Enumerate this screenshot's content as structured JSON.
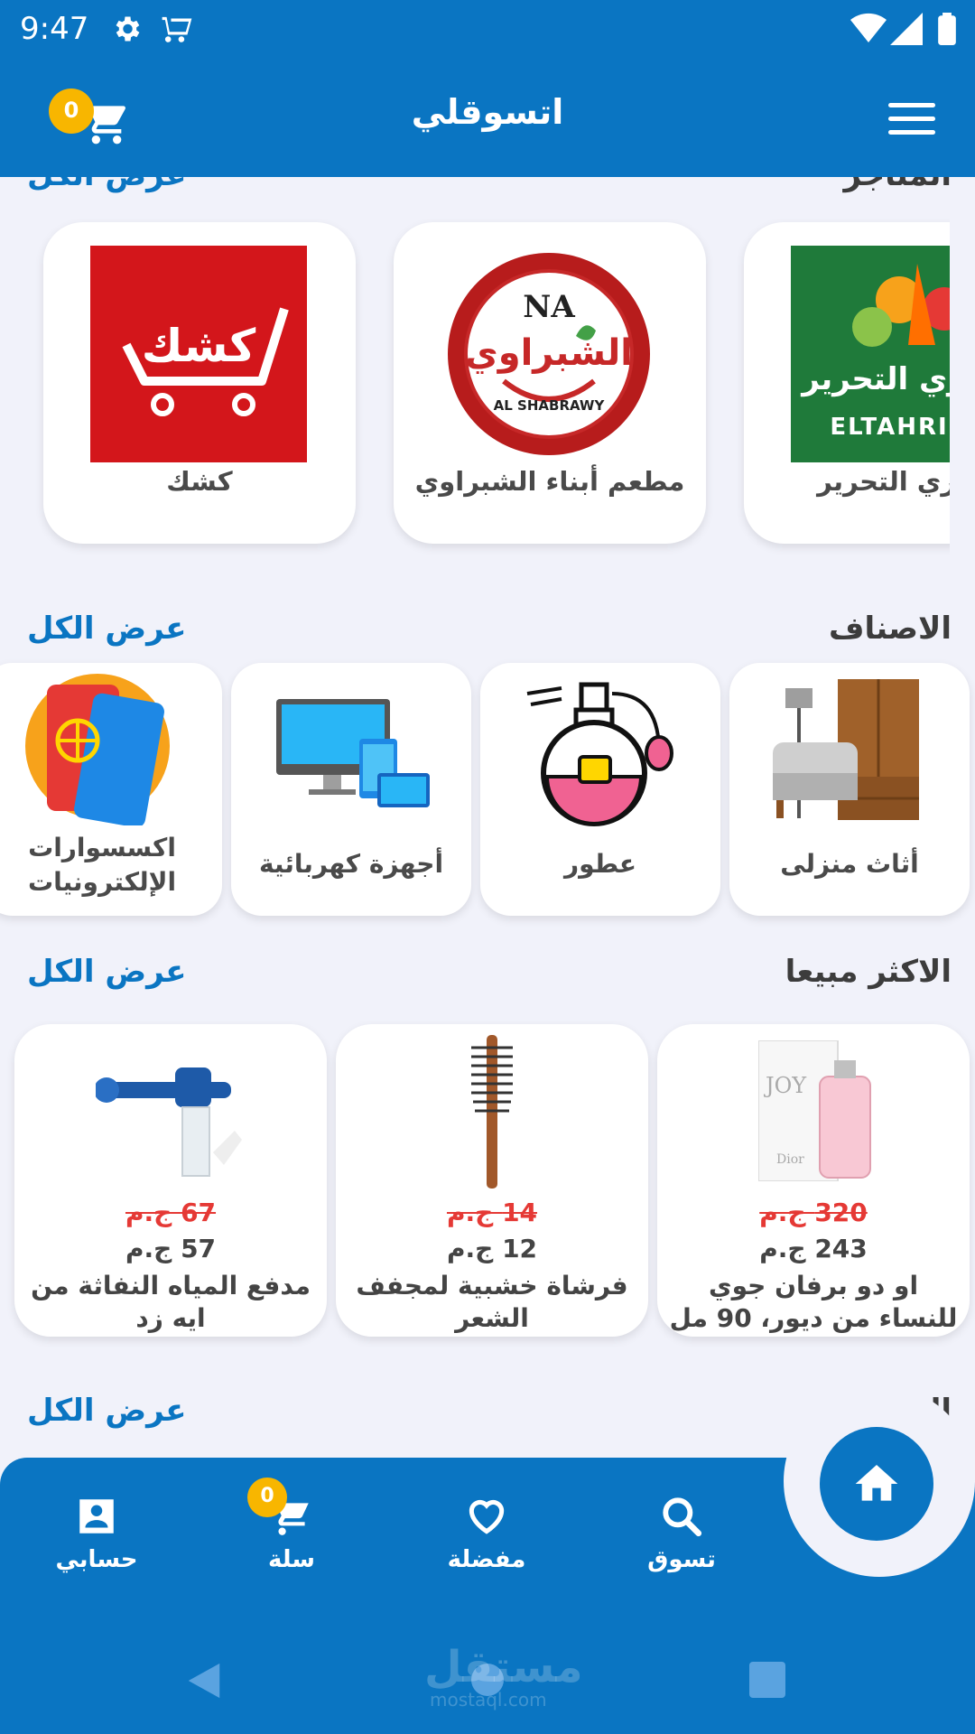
{
  "status_bar": {
    "time": "9:47"
  },
  "app_bar": {
    "title": "اتسوقلي",
    "cart_count": "0"
  },
  "stores": {
    "title": "المتاجر",
    "view_all": "عرض الكل",
    "items": [
      {
        "name": "سري التحرير",
        "logo_text": "شري التحرير",
        "logo_sub": "ELTAHRIR"
      },
      {
        "name": "مطعم أبناء الشبراوي",
        "logo_text": "الشبراوي",
        "logo_sub": "AL SHABRAWY",
        "logo_top": "NA"
      },
      {
        "name": "كشك",
        "logo_text": "كشك"
      }
    ]
  },
  "categories": {
    "title": "الاصناف",
    "view_all": "عرض الكل",
    "items": [
      {
        "name": "أثاث منزلى",
        "icon": "furniture-icon"
      },
      {
        "name": "عطور",
        "icon": "perfume-icon"
      },
      {
        "name": "أجهزة كهربائية",
        "icon": "electronics-icon"
      },
      {
        "name": "اكسسوارات الإلكترونيات",
        "icon": "phone-accessories-icon"
      }
    ]
  },
  "best_sellers": {
    "title": "الاكثر مبيعا",
    "view_all": "عرض الكل",
    "items": [
      {
        "old_price": "320 ج.م",
        "price": "243 ج.م",
        "name": "او دو برفان جوي للنساء من ديور، 90 مل",
        "image_text": "JOY",
        "image_sub": "Dior"
      },
      {
        "old_price": "14 ج.م",
        "price": "12 ج.م",
        "name": "فرشاة خشبية لمجفف الشعر"
      },
      {
        "old_price": "67 ج.م",
        "price": "57 ج.م",
        "name": "مدفع المياه النفاثة من ايه زد"
      }
    ]
  },
  "shops_section": {
    "title": "المتجات",
    "view_all": "عرض الكل"
  },
  "bottom_nav": {
    "items": [
      {
        "label": "حسابي",
        "icon": "account-icon"
      },
      {
        "label": "سلة",
        "icon": "cart-icon",
        "badge": "0"
      },
      {
        "label": "مفضلة",
        "icon": "heart-icon"
      },
      {
        "label": "تسوق",
        "icon": "search-icon"
      }
    ],
    "home_icon": "home-icon"
  },
  "watermark": {
    "text": "مستقل",
    "sub": "mostaql.com"
  },
  "colors": {
    "primary": "#0a75c2",
    "badge": "#f8b600",
    "old_price": "#e53935",
    "background": "#f1f2fa"
  }
}
